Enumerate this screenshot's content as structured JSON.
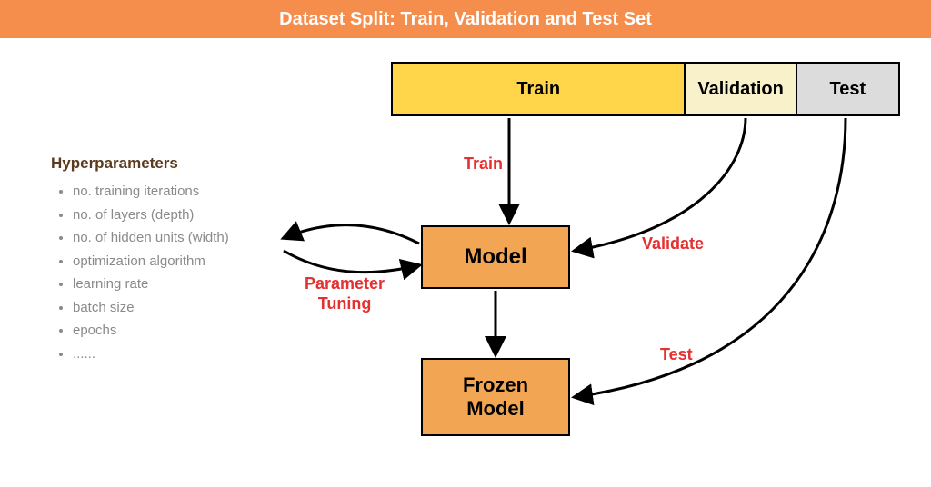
{
  "header": {
    "title": "Dataset Split: Train, Validation and Test Set"
  },
  "dataset_bar": {
    "train_label": "Train",
    "validation_label": "Validation",
    "test_label": "Test"
  },
  "boxes": {
    "model_label": "Model",
    "frozen_model_line1": "Frozen",
    "frozen_model_line2": "Model"
  },
  "hyperparameters": {
    "title": "Hyperparameters",
    "items": [
      "no. training iterations",
      "no. of layers (depth)",
      "no. of hidden units (width)",
      "optimization algorithm",
      "learning rate",
      "batch size",
      "epochs",
      "......"
    ]
  },
  "arrow_labels": {
    "train": "Train",
    "validate": "Validate",
    "parameter_tuning_line1": "Parameter",
    "parameter_tuning_line2": "Tuning",
    "test": "Test"
  },
  "colors": {
    "header_bg": "#f58e4d",
    "box_bg": "#f2a653",
    "train_seg": "#ffd54a",
    "val_seg": "#f8f1c9",
    "test_seg": "#dcdcdc",
    "label_red": "#e53030",
    "hyper_title": "#5c3a1e",
    "hyper_item": "#8a8a8a"
  }
}
